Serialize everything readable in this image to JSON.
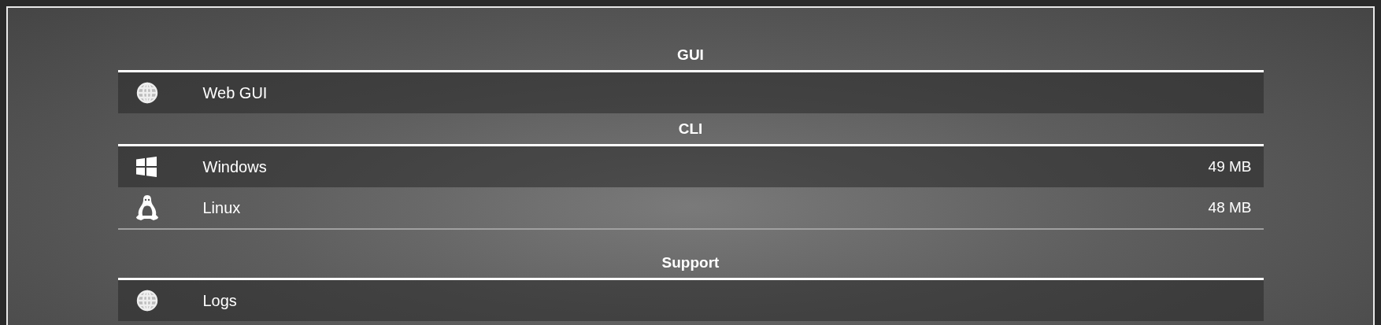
{
  "sections": [
    {
      "heading": "GUI",
      "items": [
        {
          "kind": "web",
          "label": "Web GUI"
        }
      ]
    },
    {
      "heading": "CLI",
      "items": [
        {
          "kind": "windows",
          "label": "Windows",
          "size": "49 MB"
        },
        {
          "kind": "linux",
          "label": "Linux",
          "size": "48 MB"
        }
      ]
    },
    {
      "heading": "Support",
      "items": [
        {
          "kind": "web",
          "label": "Logs"
        }
      ]
    }
  ]
}
